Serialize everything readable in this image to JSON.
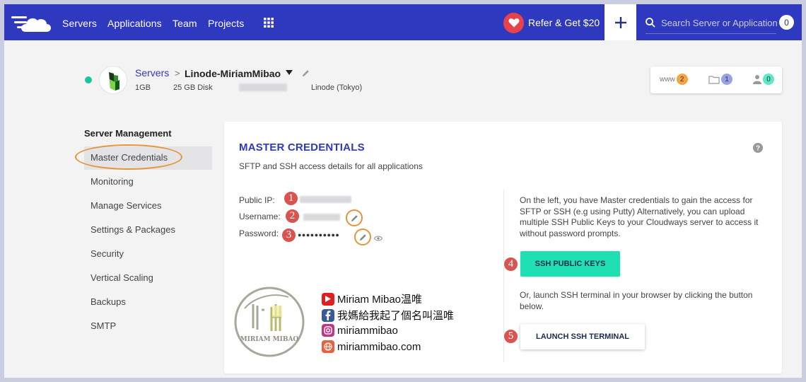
{
  "nav": {
    "links": [
      "Servers",
      "Applications",
      "Team",
      "Projects"
    ],
    "refer_label": "Refer & Get $20",
    "search_placeholder": "Search Server or Application",
    "notification_count": "0"
  },
  "server": {
    "breadcrumb_parent": "Servers",
    "breadcrumb_sep": ">",
    "name": "Linode-MiriamMibao",
    "ram": "1GB",
    "disk": "25 GB Disk",
    "provider": "Linode (Tokyo)",
    "stats": {
      "www": "www",
      "apps": "2",
      "files": "1",
      "users": "0"
    }
  },
  "menu": {
    "heading": "Server Management",
    "items": [
      "Master Credentials",
      "Monitoring",
      "Manage Services",
      "Settings & Packages",
      "Security",
      "Vertical Scaling",
      "Backups",
      "SMTP"
    ],
    "active_index": 0
  },
  "card": {
    "title": "MASTER CREDENTIALS",
    "subtitle": "SFTP and SSH access details for all applications",
    "labels": {
      "public_ip": "Public IP:",
      "username": "Username:",
      "password": "Password:"
    },
    "password_masked": "●●●●●●●●●●",
    "right_description": "On the left, you have Master credentials to gain the access for SFTP or SSH (e.g using Putty) Alternatively, you can upload multiple SSH Public Keys to your Cloudways server to access it without password prompts.",
    "ssh_keys_label": "SSH PUBLIC KEYS",
    "terminal_description": "Or, launch SSH terminal in your browser by clicking the button below.",
    "ssh_terminal_label": "LAUNCH SSH TERMINAL"
  },
  "annotations": [
    "1",
    "2",
    "3",
    "4",
    "5"
  ],
  "watermark": {
    "seal_text": "MIRIAM MIBAO",
    "lines": [
      "Miriam Mibao温唯",
      "我媽給我起了個名叫溫唯",
      "miriammibao",
      "miriammibao.com"
    ]
  },
  "colors": {
    "nav_bg": "#2f39bf",
    "accent": "#1ee0b3",
    "annotation_red": "#d9534f",
    "highlight_orange": "#e5943a"
  }
}
